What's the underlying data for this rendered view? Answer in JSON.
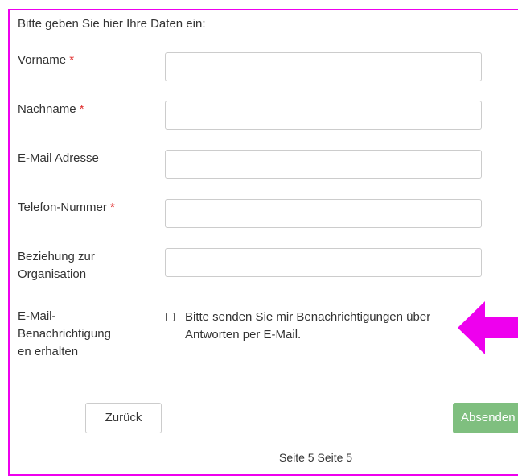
{
  "form": {
    "intro": "Bitte geben Sie hier Ihre Daten ein:",
    "required_marker": "*",
    "fields": [
      {
        "label": "Vorname",
        "required": true,
        "value": ""
      },
      {
        "label": "Nachname",
        "required": true,
        "value": ""
      },
      {
        "label": "E-Mail Adresse",
        "required": false,
        "value": ""
      },
      {
        "label": "Telefon-Nummer",
        "required": true,
        "value": ""
      },
      {
        "label": "Beziehung zur Organisation",
        "required": false,
        "value": ""
      }
    ],
    "notifications": {
      "label": "E-Mail-Benachrichtigungen erhalten",
      "checkbox_text": "Bitte senden Sie mir Benachrichtigungen über Antworten per E-Mail.",
      "checked": false
    }
  },
  "buttons": {
    "back": "Zurück",
    "submit": "Absenden"
  },
  "pager": {
    "text": "Seite 5 Seite 5"
  },
  "colors": {
    "highlight": "#ee00ee",
    "required": "#e03030",
    "submit_bg": "#7fbf7f"
  },
  "annotation": {
    "icon": "arrow-left-icon"
  }
}
